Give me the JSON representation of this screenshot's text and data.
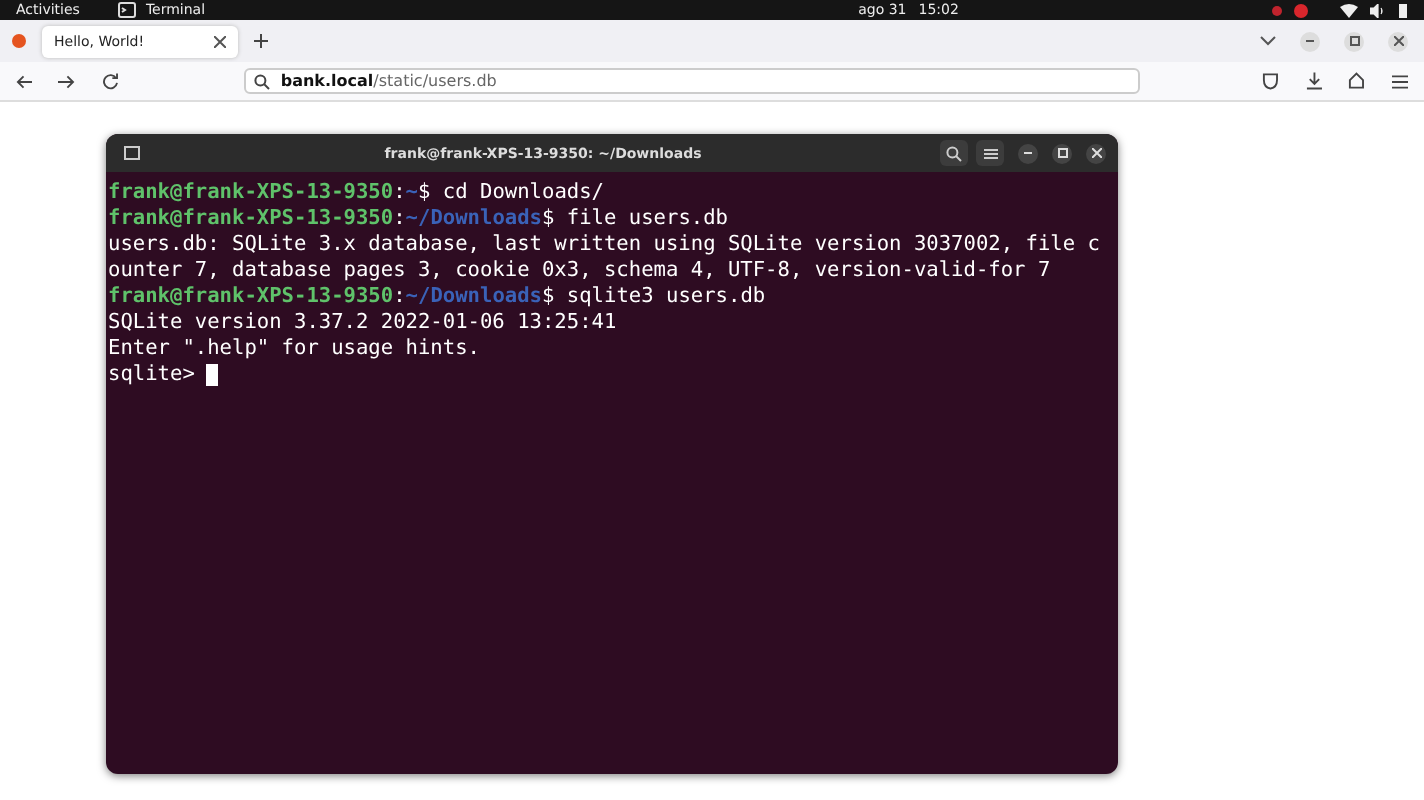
{
  "top_bar": {
    "activities": "Activities",
    "app": "Terminal",
    "date": "ago 31",
    "time": "15:02"
  },
  "browser": {
    "tabs": [
      {
        "title": "Hello, World!",
        "selected": true
      }
    ],
    "address": {
      "host": "bank.local",
      "path": "/static/users.db"
    }
  },
  "terminal": {
    "title": "frank@frank-XPS-13-9350: ~/Downloads",
    "lines": [
      {
        "kind": "prompt",
        "user": "frank@frank-XPS-13-9350",
        "sep": ":",
        "path": "~",
        "command": "$ cd Downloads/"
      },
      {
        "kind": "prompt",
        "user": "frank@frank-XPS-13-9350",
        "sep": ":",
        "path": "~/Downloads",
        "command": "$ file users.db"
      },
      {
        "kind": "output",
        "text": "users.db: SQLite 3.x database, last written using SQLite version 3037002, file c"
      },
      {
        "kind": "output",
        "text": "ounter 7, database pages 3, cookie 0x3, schema 4, UTF-8, version-valid-for 7"
      },
      {
        "kind": "prompt",
        "user": "frank@frank-XPS-13-9350",
        "sep": ":",
        "path": "~/Downloads",
        "command": "$ sqlite3 users.db"
      },
      {
        "kind": "output",
        "text": "SQLite version 3.37.2 2022-01-06 13:25:41"
      },
      {
        "kind": "output",
        "text": "Enter \".help\" for usage hints."
      },
      {
        "kind": "input",
        "text": "sqlite>"
      }
    ]
  }
}
